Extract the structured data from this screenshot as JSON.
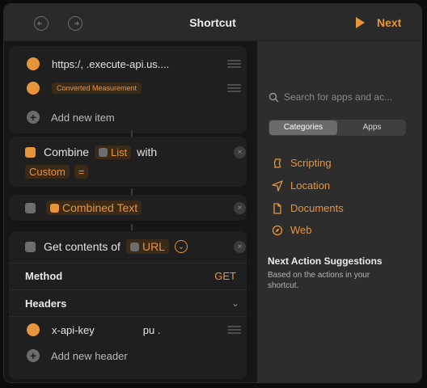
{
  "titlebar": {
    "title": "Shortcut",
    "next_label": "Next"
  },
  "editor": {
    "list_items": [
      {
        "text": "https:/,                   .execute-api.us...."
      },
      {
        "chip": "Converted Measurement"
      }
    ],
    "add_item_label": "Add new item",
    "combine": {
      "word": "Combine",
      "list_chip": "List",
      "with": "with",
      "custom_chip": "Custom",
      "equals": "="
    },
    "combined_text_chip": "Combined Text",
    "get_contents": {
      "label": "Get contents of",
      "url_chip": "URL"
    },
    "method": {
      "label": "Method",
      "value": "GET"
    },
    "headers_label": "Headers",
    "header_item": {
      "key": "x-api-key",
      "value": "pu                  ."
    },
    "add_header_label": "Add new header"
  },
  "panel": {
    "search_placeholder": "Search for apps and ac...",
    "segments": [
      "Categories",
      "Apps"
    ],
    "categories": [
      "Scripting",
      "Location",
      "Documents",
      "Web"
    ],
    "suggestions_title": "Next Action Suggestions",
    "suggestions_sub": "Based on the actions in your shortcut."
  },
  "colors": {
    "accent": "#e8943a",
    "panel": "#2d2d2d",
    "editor": "#161616"
  },
  "icons": [
    "undo-icon",
    "redo-icon",
    "play-icon",
    "search-icon",
    "scripting-icon",
    "location-icon",
    "documents-icon",
    "web-icon"
  ]
}
